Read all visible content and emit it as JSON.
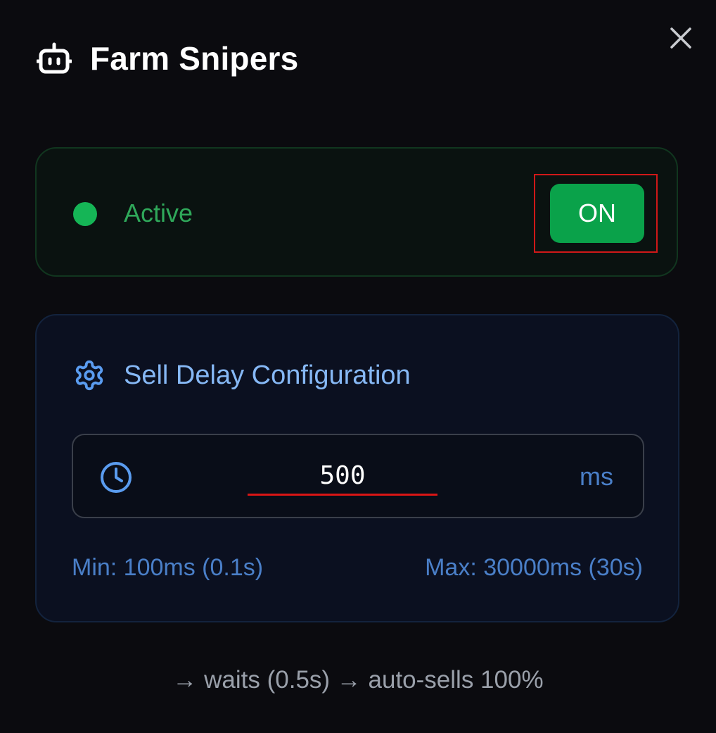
{
  "header": {
    "title": "Farm Snipers",
    "icon": "bot-icon",
    "close_icon": "close-icon"
  },
  "status": {
    "label": "Active",
    "toggle_label": "ON",
    "active": true,
    "colors": {
      "dot": "#15b556",
      "label": "#2fa85a",
      "toggle": "#0aa24a"
    }
  },
  "config": {
    "title": "Sell Delay Configuration",
    "icon": "gear-icon",
    "delay": {
      "value": "500",
      "unit": "ms",
      "icon": "clock-icon"
    },
    "min_label": "Min: 100ms (0.1s)",
    "max_label": "Max: 30000ms (30s)",
    "accent_color": "#86b8f5"
  },
  "footer": {
    "text": "→ waits (0.5s) → auto-sells 100%"
  }
}
